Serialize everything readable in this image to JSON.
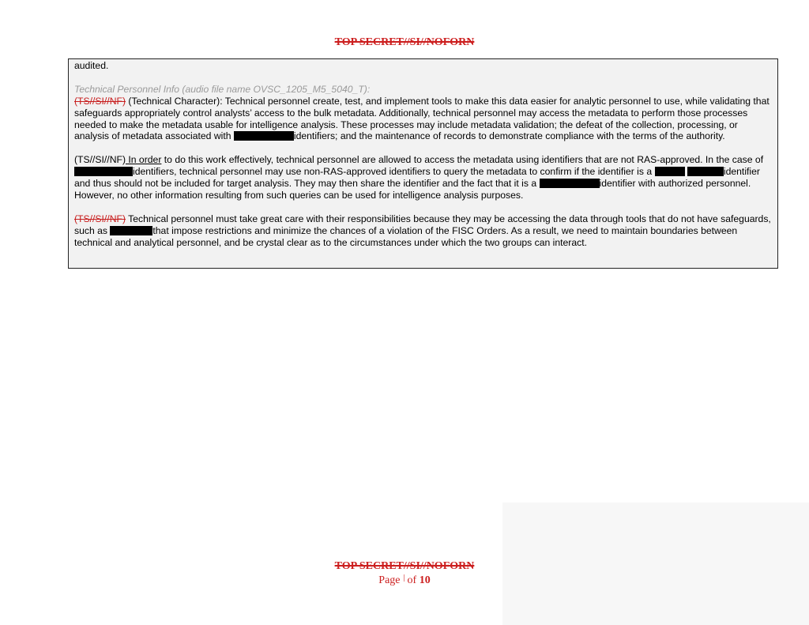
{
  "header": {
    "classification": "TOP SECRET//SI//NOFORN"
  },
  "footer": {
    "classification": "TOP SECRET//SI//NOFORN",
    "page_label": "Page",
    "of_label": "of",
    "total_pages": "10"
  },
  "content": {
    "line_audited": "audited.",
    "speaker": "Technical Personnel Info (audio file name OVSC_1205_M5_5040_T):",
    "p1": {
      "marking": "(TS//SI//NF)",
      "text_a": " (Technical Character): Technical personnel create, test, and implement tools to make this data easier for analytic personnel to use, while validating that safeguards appropriately control analysts’ access to the bulk metadata. Additionally, technical personnel may access the metadata to perform those processes needed to make the metadata usable for intelligence analysis. These processes may include metadata validation; the defeat of the collection, processing, or analysis of metadata associated with ",
      "text_b": "identifiers; and the maintenance of records to demonstrate compliance with the terms of the authority."
    },
    "p2": {
      "marking": "(TS//SI//NF)",
      "lead": " In order",
      "text_a": " to do this work effectively, technical personnel are allowed to access the metadata using identifiers that are not RAS-approved. In the case of ",
      "text_b": "identifiers, technical personnel may use non-RAS-approved identifiers to query the metadata to confirm if the identifier is a ",
      "text_c": "identifier and thus should not be included for target analysis. They may then share the identifier and the fact that it is a ",
      "text_d": "identifier with authorized personnel. However, no other information resulting from such queries can be used for intelligence analysis purposes."
    },
    "p3": {
      "marking": "(TS//SI//NF)",
      "text_a": " Technical personnel must take great care with their responsibilities because they may be accessing the data through tools that do not have safeguards, such as ",
      "text_b": "that impose restrictions and minimize the chances of a violation of the FISC Orders. As a result, we need to maintain boundaries between technical and analytical personnel, and be crystal clear as to the circumstances under which the two groups can interact."
    }
  }
}
